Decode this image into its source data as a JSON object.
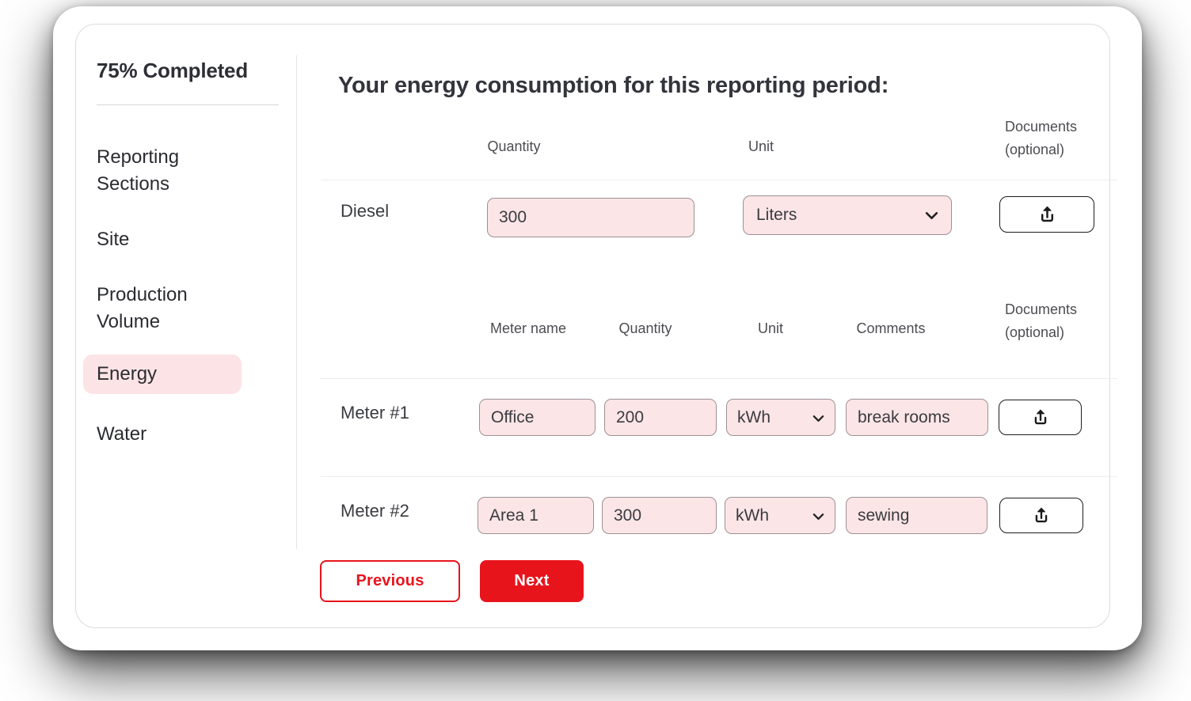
{
  "sidebar": {
    "progress_label": "75% Completed",
    "items": [
      {
        "label": "Reporting Sections",
        "active": false
      },
      {
        "label": "Site",
        "active": false
      },
      {
        "label": "Production Volume",
        "active": false
      },
      {
        "label": "Energy",
        "active": true
      },
      {
        "label": "Water",
        "active": false
      }
    ]
  },
  "main": {
    "title": "Your energy consumption for this reporting period:",
    "fuel_table": {
      "headers": {
        "quantity": "Quantity",
        "unit": "Unit",
        "documents_line1": "Documents",
        "documents_line2": "(optional)"
      },
      "rows": [
        {
          "label": "Diesel",
          "quantity": "300",
          "unit": "Liters"
        }
      ]
    },
    "meter_table": {
      "headers": {
        "meter_name": "Meter name",
        "quantity": "Quantity",
        "unit": "Unit",
        "comments": "Comments",
        "documents_line1": "Documents",
        "documents_line2": "(optional)"
      },
      "rows": [
        {
          "label": "Meter #1",
          "meter_name": "Office",
          "quantity": "200",
          "unit": "kWh",
          "comments": "break rooms"
        },
        {
          "label": "Meter #2",
          "meter_name": "Area 1",
          "quantity": "300",
          "unit": "kWh",
          "comments": "sewing"
        }
      ]
    },
    "buttons": {
      "previous": "Previous",
      "next": "Next"
    }
  },
  "icons": {
    "upload": "upload-icon",
    "chevron": "chevron-down-icon"
  },
  "colors": {
    "accent_red": "#e8141c",
    "pink_fill": "#fbe5e6",
    "active_nav_pink": "#fce4e6"
  }
}
